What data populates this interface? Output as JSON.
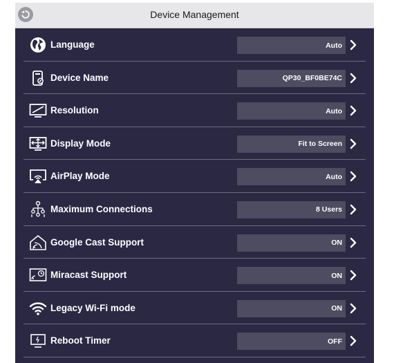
{
  "window": {
    "title": "Device Management",
    "back_icon": "back-icon"
  },
  "colors": {
    "panel_bg": "#2a2843",
    "titlebar_bg": "#e7e7ea",
    "value_box_bg": "#4d4c60",
    "divider": "#6e6d84",
    "text": "#ffffff"
  },
  "settings": [
    {
      "label": "Language",
      "value": "Auto",
      "icon": "globe-icon"
    },
    {
      "label": "Device Name",
      "value": "QP30_BF0BE74C",
      "icon": "device-edit-icon"
    },
    {
      "label": "Resolution",
      "value": "Auto",
      "icon": "monitor-icon"
    },
    {
      "label": "Display Mode",
      "value": "Fit to Screen",
      "icon": "fit-screen-icon"
    },
    {
      "label": "AirPlay Mode",
      "value": "Auto",
      "icon": "airplay-icon"
    },
    {
      "label": "Maximum Connections",
      "value": "8 Users",
      "icon": "connections-icon"
    },
    {
      "label": "Google Cast Support",
      "value": "ON",
      "icon": "cast-icon"
    },
    {
      "label": "Miracast Support",
      "value": "ON",
      "icon": "miracast-icon"
    },
    {
      "label": "Legacy Wi-Fi mode",
      "value": "ON",
      "icon": "wifi-icon"
    },
    {
      "label": "Reboot Timer",
      "value": "OFF",
      "icon": "reboot-timer-icon"
    }
  ]
}
